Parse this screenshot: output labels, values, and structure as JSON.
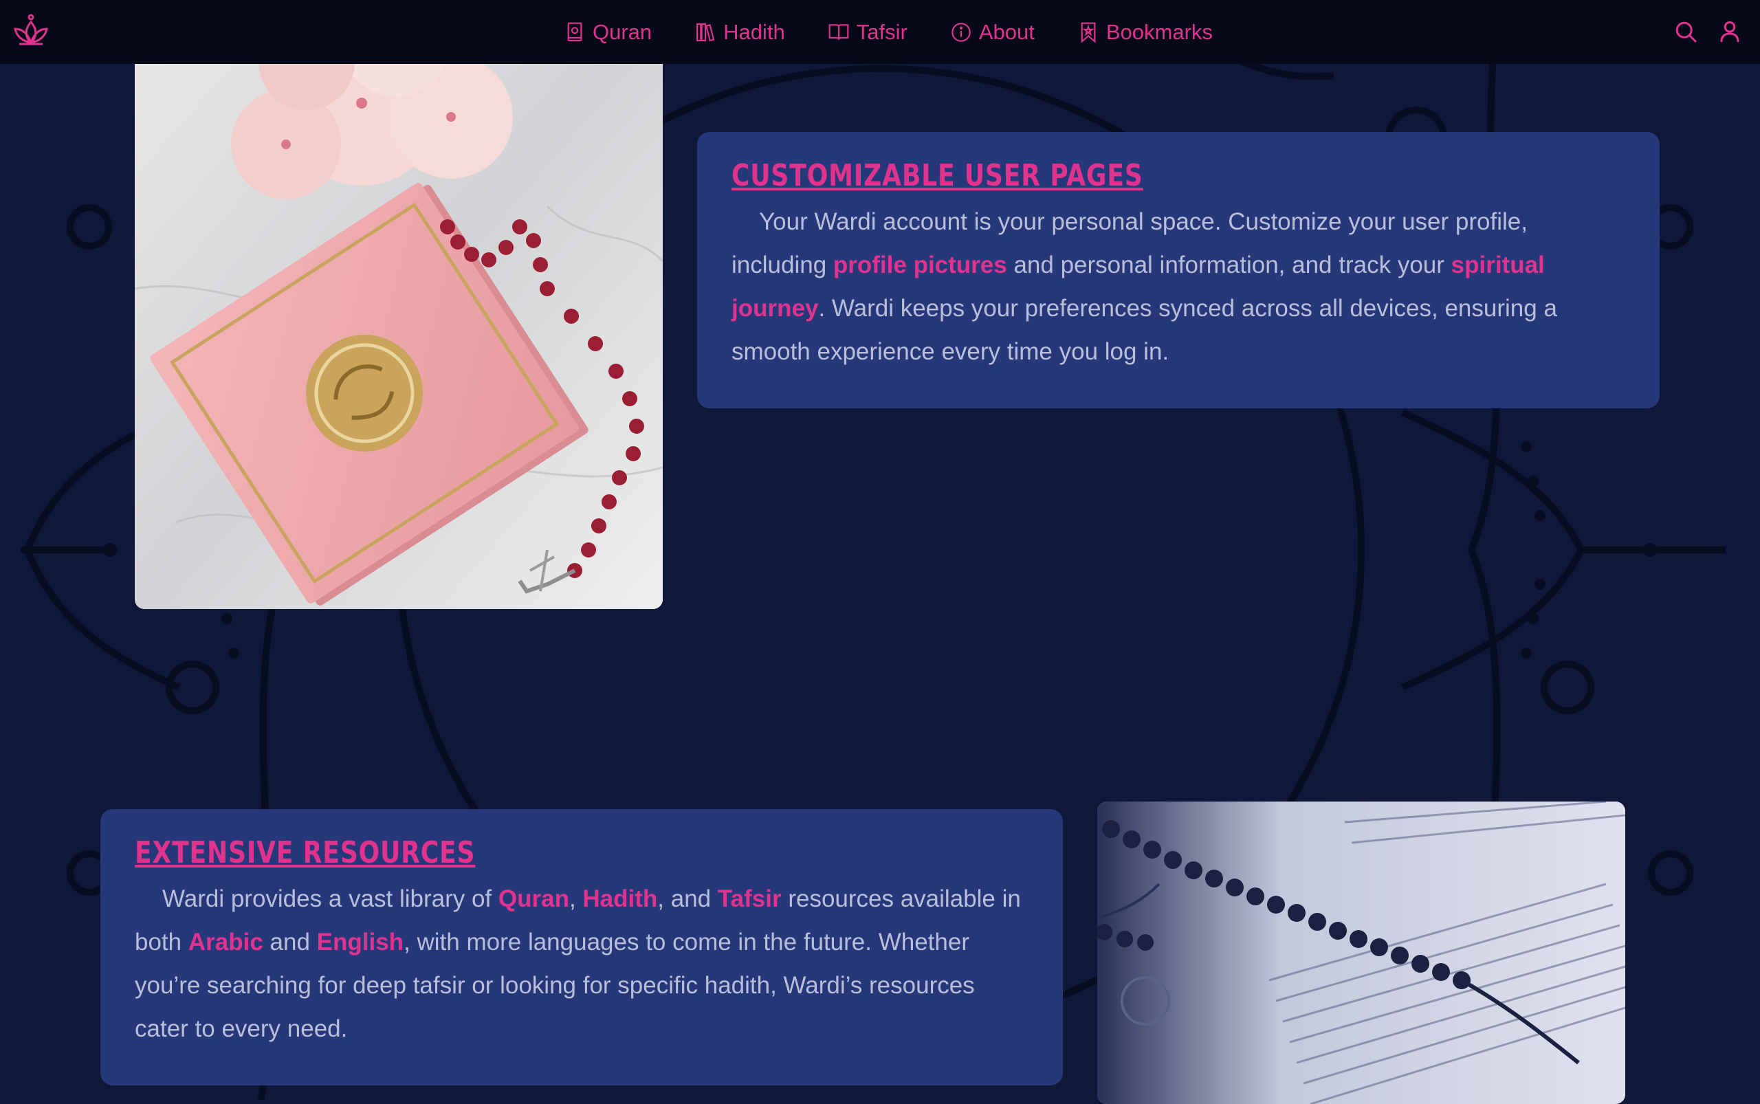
{
  "nav": {
    "items": [
      {
        "label": "Quran",
        "icon": "quran-icon"
      },
      {
        "label": "Hadith",
        "icon": "books-icon"
      },
      {
        "label": "Tafsir",
        "icon": "open-book-icon"
      },
      {
        "label": "About",
        "icon": "info-icon"
      },
      {
        "label": "Bookmarks",
        "icon": "bookmark-icon"
      }
    ],
    "right_icons": [
      "search-icon",
      "user-icon"
    ],
    "accent": "#e0338e"
  },
  "sections": {
    "user_pages": {
      "title": "Customizable User Pages",
      "p1": "Your Wardi account is your personal space. Customize your user profile, including ",
      "hl1": "profile pictures",
      "p2": " and personal information, and track your ",
      "hl2": "spiritual journey",
      "p3": ". Wardi keeps your preferences synced across all devices, ensuring a smooth experience every time you log in."
    },
    "resources": {
      "title": "Extensive Resources",
      "p1": "Wardi provides a vast library of ",
      "hl1": "Quran",
      "p2": ", ",
      "hl2": "Hadith",
      "p3": ", and ",
      "hl3": "Tafsir",
      "p4": " resources available in both ",
      "hl4": "Arabic",
      "p5": " and ",
      "hl5": "English",
      "p6": ", with more languages to come in the future. Whether you’re searching for deep tafsir or looking for specific hadith, Wardi’s resources cater to every need."
    }
  },
  "colors": {
    "background": "#0f1838",
    "card": "#26387a",
    "accent": "#e0338e",
    "text": "#b9bfd8"
  }
}
